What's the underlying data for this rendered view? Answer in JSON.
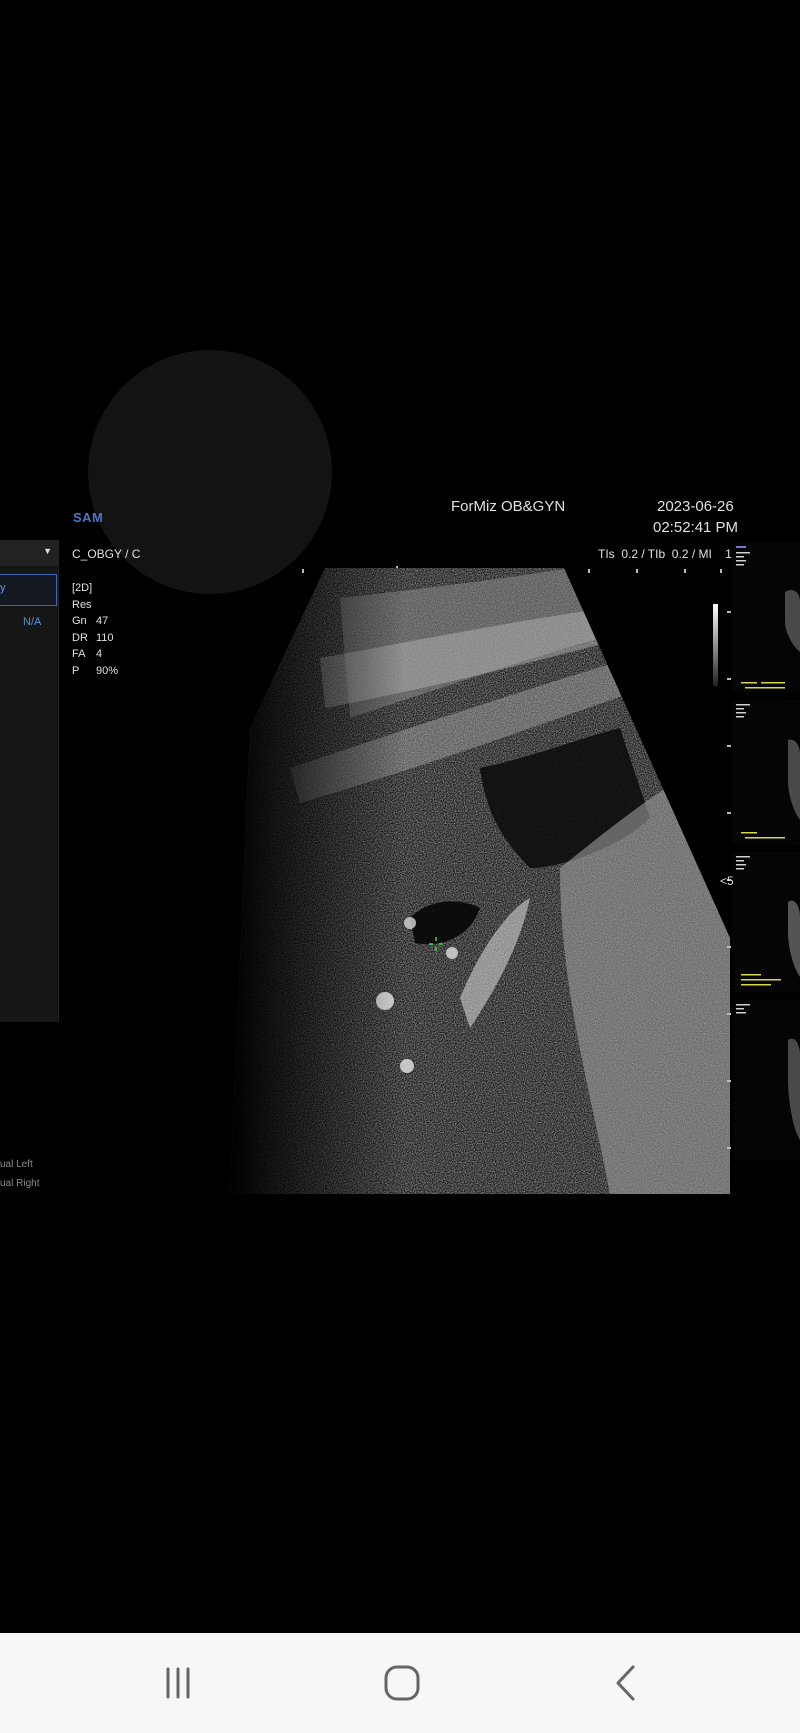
{
  "header": {
    "logo_text": "SAM",
    "hospital": "ForMiz OB&GYN",
    "date": "2023-06-26",
    "time": "02:52:41 PM",
    "preset": "C_OBGY / C",
    "indices": "TIs  0.2 / TIb  0.2 / MI    1.0"
  },
  "left_panel": {
    "selected_item": "y",
    "na_value": "N/A",
    "dual_left": "ual Left",
    "dual_right": "ual Right"
  },
  "params": {
    "mode": "[2D]",
    "res": "Res",
    "gn_label": "Gn",
    "gn_value": "47",
    "dr_label": "DR",
    "dr_value": "110",
    "fa_label": "FA",
    "fa_value": "4",
    "p_label": "P",
    "p_value": "90%"
  },
  "focus_marker": "5",
  "colors": {
    "accent": "#4a76c9",
    "cursor": "#33dd55",
    "thumb_text": "#d8d84a"
  },
  "nav": {
    "recents_icon": "recents-icon",
    "home_icon": "home-icon",
    "back_icon": "back-icon"
  }
}
